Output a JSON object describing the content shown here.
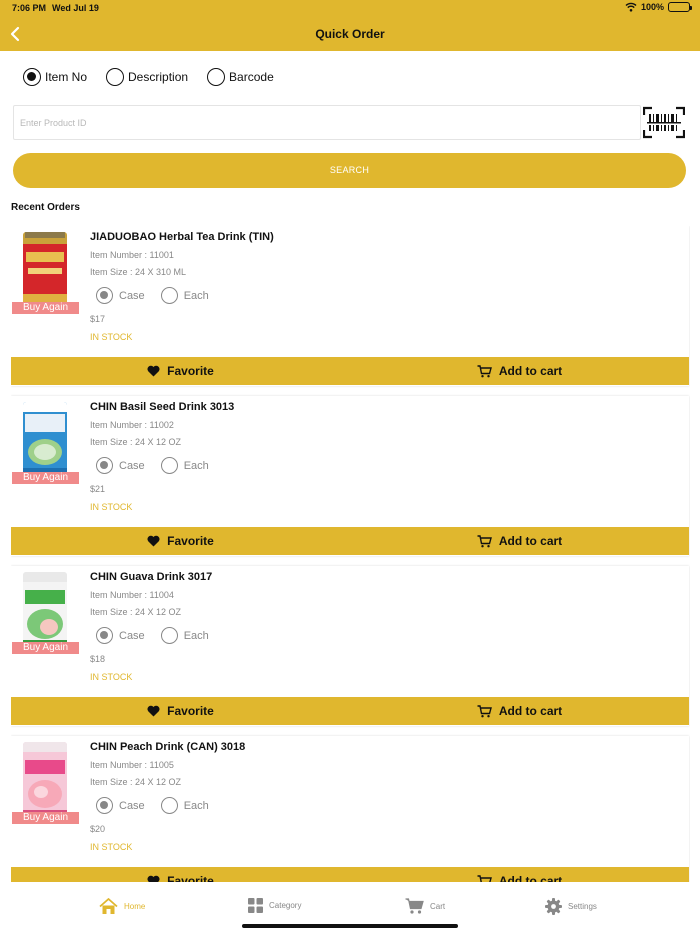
{
  "status": {
    "time": "7:06 PM",
    "date": "Wed Jul 19",
    "battery": "100%"
  },
  "header": {
    "title": "Quick Order",
    "back_icon": "chevron-left-icon"
  },
  "search": {
    "types": [
      {
        "label": "Item No",
        "selected": true
      },
      {
        "label": "Description",
        "selected": false
      },
      {
        "label": "Barcode",
        "selected": false
      }
    ],
    "placeholder": "Enter Product ID",
    "value": "",
    "button_label": "SEARCH"
  },
  "recent": {
    "title": "Recent Orders",
    "items": [
      {
        "name": "JIADUOBAO Herbal Tea Drink (TIN)",
        "item_number": "Item Number : 11001",
        "item_size": "Item Size : 24 X 310 ML",
        "unit_case": "Case",
        "unit_each": "Each",
        "selected_unit": "Case",
        "price": "$17",
        "stock": "IN STOCK",
        "buy_again": "Buy Again",
        "favorite": "Favorite",
        "add_to_cart": "Add to cart"
      },
      {
        "name": "CHIN  Basil Seed Drink 3013",
        "item_number": "Item Number : 11002",
        "item_size": "Item Size : 24 X 12 OZ",
        "unit_case": "Case",
        "unit_each": "Each",
        "selected_unit": "Case",
        "price": "$21",
        "stock": "IN STOCK",
        "buy_again": "Buy Again",
        "favorite": "Favorite",
        "add_to_cart": "Add to cart"
      },
      {
        "name": "CHIN  Guava Drink 3017",
        "item_number": "Item Number : 11004",
        "item_size": "Item Size : 24 X 12 OZ",
        "unit_case": "Case",
        "unit_each": "Each",
        "selected_unit": "Case",
        "price": "$18",
        "stock": "IN STOCK",
        "buy_again": "Buy Again",
        "favorite": "Favorite",
        "add_to_cart": "Add to cart"
      },
      {
        "name": "CHIN  Peach Drink (CAN) 3018",
        "item_number": "Item Number : 11005",
        "item_size": "Item Size : 24 X 12 OZ",
        "unit_case": "Case",
        "unit_each": "Each",
        "selected_unit": "Case",
        "price": "$20",
        "stock": "IN STOCK",
        "buy_again": "Buy Again",
        "favorite": "Favorite",
        "add_to_cart": "Add to cart"
      }
    ]
  },
  "tabs": [
    {
      "label": "Home",
      "icon": "home-icon",
      "active": true
    },
    {
      "label": "Category",
      "icon": "grid-icon",
      "active": false
    },
    {
      "label": "Cart",
      "icon": "cart-icon",
      "active": false
    },
    {
      "label": "Settings",
      "icon": "gear-icon",
      "active": false
    }
  ],
  "colors": {
    "accent": "#e0b72e",
    "buy_again": "#f08a8a",
    "muted_text": "#888888"
  }
}
